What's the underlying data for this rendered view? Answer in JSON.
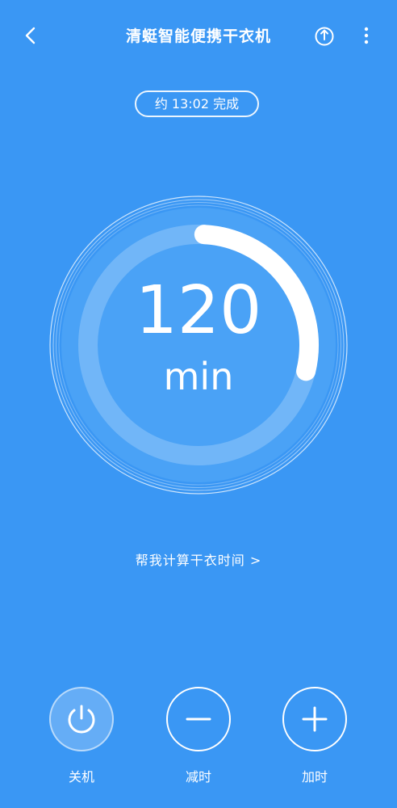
{
  "header": {
    "title": "清蜓智能便携干衣机",
    "back_icon": "chevron-left-icon",
    "share_icon": "share-icon",
    "more_icon": "more-vertical-icon"
  },
  "eta": {
    "label": "约 13:02 完成"
  },
  "timer": {
    "value": "120",
    "unit": "min",
    "progress_fraction": 0.28
  },
  "calc_link": {
    "label": "帮我计算干衣时间 >"
  },
  "controls": {
    "power": {
      "label": "关机",
      "icon": "power-icon"
    },
    "minus": {
      "label": "减时",
      "icon": "minus-icon"
    },
    "plus": {
      "label": "加时",
      "icon": "plus-icon"
    }
  },
  "colors": {
    "background": "#3a97f4",
    "foreground": "#ffffff"
  }
}
